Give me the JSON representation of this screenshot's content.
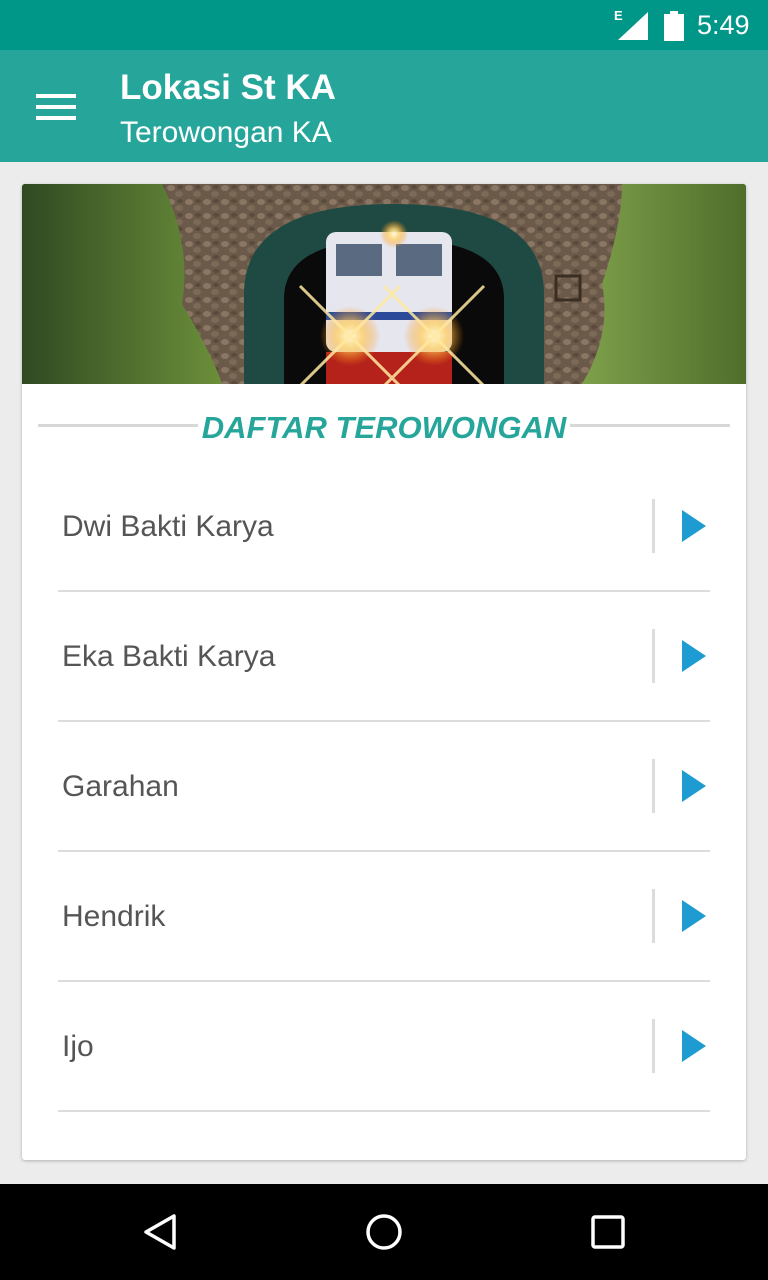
{
  "status_bar": {
    "network_type": "E",
    "time": "5:49",
    "icons": [
      "signal-icon",
      "battery-icon"
    ]
  },
  "toolbar": {
    "title": "Lokasi St KA",
    "subtitle": "Terowongan KA",
    "menu_icon": "hamburger-menu-icon",
    "background": "#26a69a"
  },
  "section": {
    "heading": "DAFTAR TEROWONGAN",
    "accent": "#26a69a"
  },
  "tunnels": [
    {
      "name": "Dwi Bakti Karya"
    },
    {
      "name": "Eka Bakti Karya"
    },
    {
      "name": "Garahan"
    },
    {
      "name": "Hendrik"
    },
    {
      "name": "Ijo"
    }
  ],
  "colors": {
    "status_bar": "#009688",
    "arrow": "#1e9bd0"
  },
  "nav_bar": {
    "icons": [
      "back-icon",
      "home-icon",
      "recents-icon"
    ]
  }
}
